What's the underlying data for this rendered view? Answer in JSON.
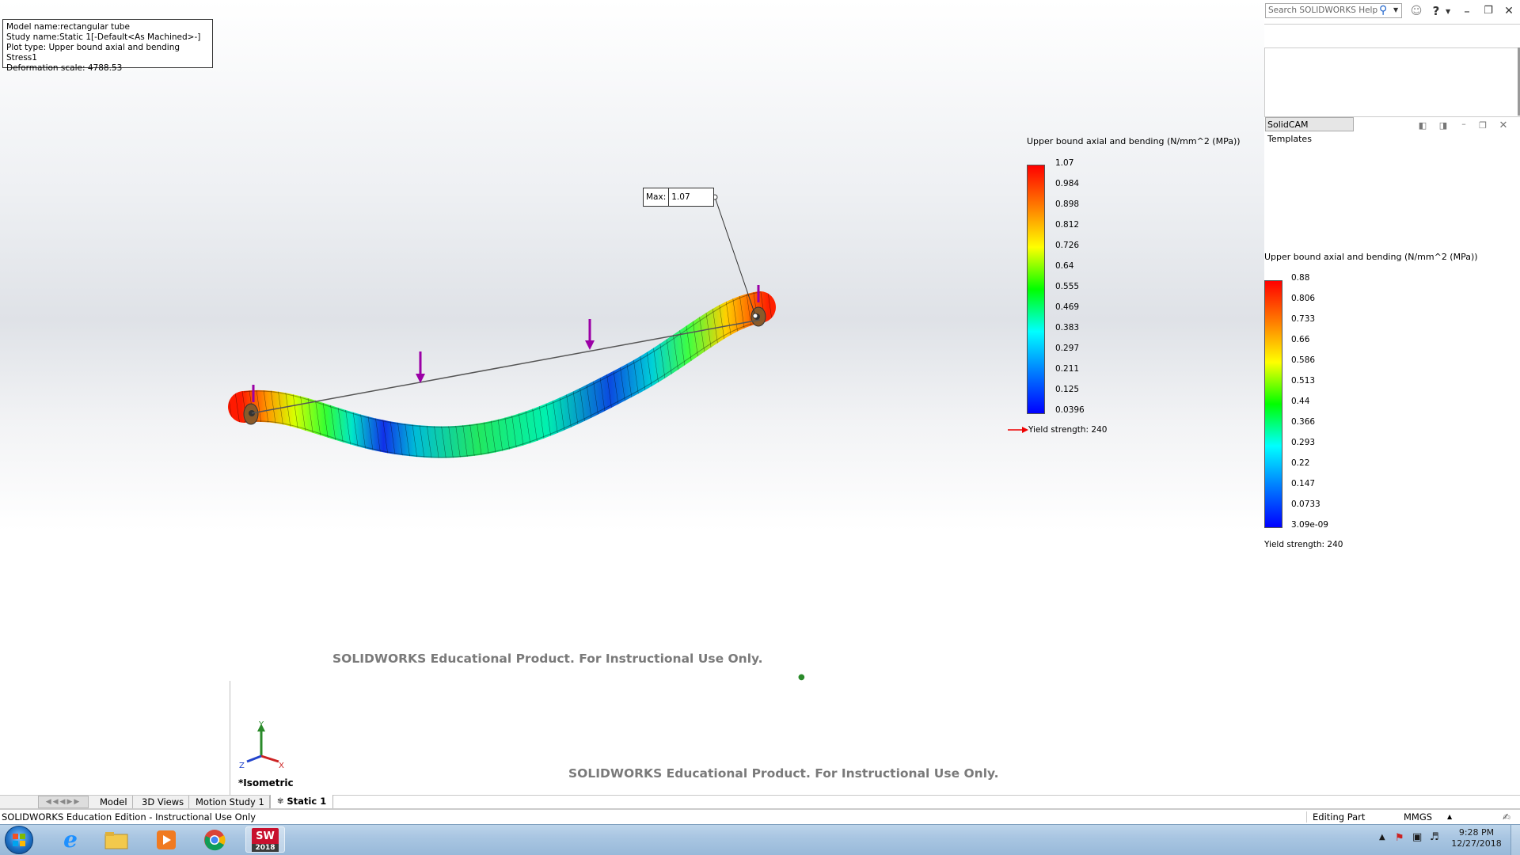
{
  "info_box": {
    "model_name": "Model name:rectangular tube",
    "study_name": "Study name:Static 1[-Default<As Machined>-]",
    "plot_type": "Plot type: Upper bound axial and bending Stress1",
    "deformation_scale": "Deformation scale: 4788.53"
  },
  "max_probe": {
    "label": "Max:",
    "value": "1.07"
  },
  "legend_main": {
    "title": "Upper bound axial and bending (N/mm^2 (MPa))",
    "ticks": [
      "1.07",
      "0.984",
      "0.898",
      "0.812",
      "0.726",
      "0.64",
      "0.555",
      "0.469",
      "0.383",
      "0.297",
      "0.211",
      "0.125",
      "0.0396"
    ],
    "yield": "Yield strength: 240"
  },
  "legend_secondary": {
    "title": "Upper bound axial and bending (N/mm^2 (MPa))",
    "ticks": [
      "0.88",
      "0.806",
      "0.733",
      "0.66",
      "0.586",
      "0.513",
      "0.44",
      "0.366",
      "0.293",
      "0.22",
      "0.147",
      "0.0733",
      "3.09e-09"
    ],
    "yield": "Yield strength: 240"
  },
  "watermark_top": "SOLIDWORKS Educational Product. For Instructional Use Only.",
  "watermark_bottom": "SOLIDWORKS Educational Product. For Instructional Use Only.",
  "view_label": "*Isometric",
  "triad": {
    "x": "X",
    "y": "Y",
    "z": "Z"
  },
  "help_search": {
    "placeholder": "Search SOLIDWORKS Help"
  },
  "window_controls": {
    "user_icon": "user-icon",
    "help": "?",
    "minimize": "–",
    "restore": "❐",
    "close": "✕"
  },
  "task_pane": {
    "tab_label": "SolidCAM Templates"
  },
  "tabs": [
    "Model",
    "3D Views",
    "Motion Study 1",
    "Static 1"
  ],
  "status_bar": {
    "left": "SOLIDWORKS Education Edition - Instructional Use Only",
    "mode": "Editing Part",
    "units": "MMGS"
  },
  "taskbar": {
    "apps": [
      "start-orb-icon",
      "internet-explorer-icon",
      "file-explorer-icon",
      "media-player-icon",
      "chrome-icon",
      "solidworks-2018-icon"
    ],
    "solidworks_label": "2018",
    "time": "9:28 PM",
    "date": "12/27/2018"
  },
  "colors": {
    "max_red": "#ff0000",
    "min_blue": "#0000ff",
    "load_arrow": "#9b00a6",
    "accent": "#2266cc"
  }
}
